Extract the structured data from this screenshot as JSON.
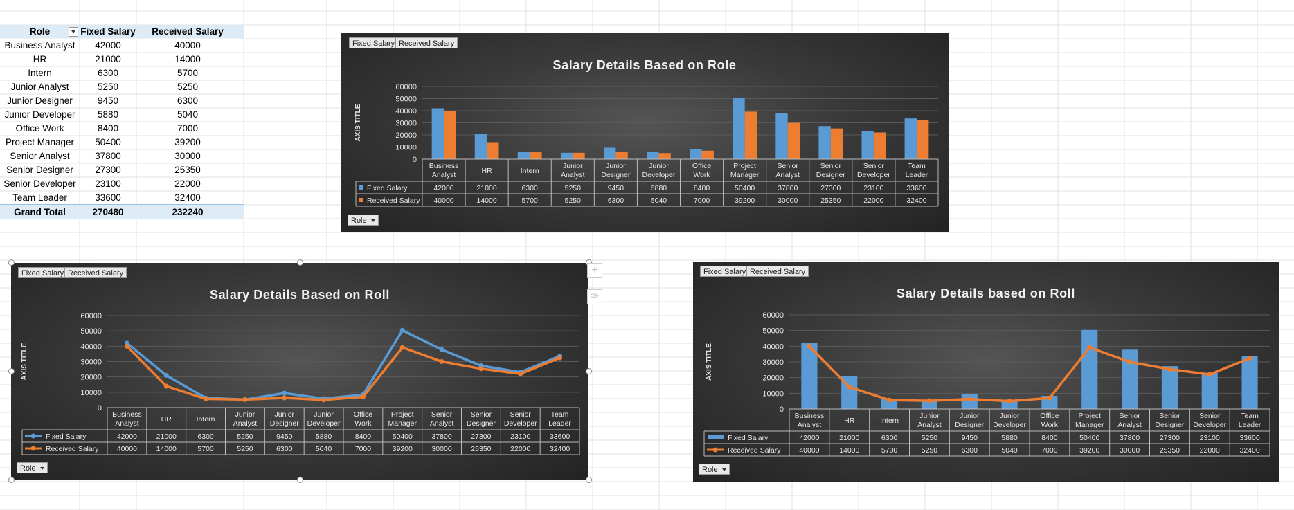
{
  "pivot": {
    "headers": [
      "Role",
      "Fixed Salary",
      "Received Salary"
    ],
    "rows": [
      {
        "role": "Business Analyst",
        "fixed": "42000",
        "received": "40000"
      },
      {
        "role": "HR",
        "fixed": "21000",
        "received": "14000"
      },
      {
        "role": "Intern",
        "fixed": "6300",
        "received": "5700"
      },
      {
        "role": "Junior Analyst",
        "fixed": "5250",
        "received": "5250"
      },
      {
        "role": "Junior Designer",
        "fixed": "9450",
        "received": "6300"
      },
      {
        "role": "Junior Developer",
        "fixed": "5880",
        "received": "5040"
      },
      {
        "role": "Office Work",
        "fixed": "8400",
        "received": "7000"
      },
      {
        "role": "Project Manager",
        "fixed": "50400",
        "received": "39200"
      },
      {
        "role": "Senior Analyst",
        "fixed": "37800",
        "received": "30000"
      },
      {
        "role": "Senior Designer",
        "fixed": "27300",
        "received": "25350"
      },
      {
        "role": "Senior Developer",
        "fixed": "23100",
        "received": "22000"
      },
      {
        "role": "Team Leader",
        "fixed": "33600",
        "received": "32400"
      }
    ],
    "total": {
      "label": "Grand Total",
      "fixed": "270480",
      "received": "232240"
    }
  },
  "field_buttons": {
    "fixed": "Fixed Salary",
    "received": "Received Salary",
    "role": "Role"
  },
  "colors": {
    "fixed": "#5b9bd5",
    "received": "#ed7d31",
    "grid": "#e0e0e0"
  },
  "icons": [
    "chart-elements-plus-icon",
    "chart-styles-brush-icon",
    "dropdown-arrow-icon"
  ],
  "chart_data": [
    {
      "type": "bar",
      "title": "Salary Details Based on Role",
      "ylabel": "AXIS TITLE",
      "ylim": [
        0,
        60000
      ],
      "yticks": [
        "0",
        "10000",
        "20000",
        "30000",
        "40000",
        "50000",
        "60000"
      ],
      "categories": [
        "Business Analyst",
        "HR",
        "Intern",
        "Junior Analyst",
        "Junior Designer",
        "Junior Developer",
        "Office Work",
        "Project Manager",
        "Senior Analyst",
        "Senior Designer",
        "Senior Developer",
        "Team Leader"
      ],
      "series": [
        {
          "name": "Fixed Salary",
          "values": [
            42000,
            21000,
            6300,
            5250,
            9450,
            5880,
            8400,
            50400,
            37800,
            27300,
            23100,
            33600
          ]
        },
        {
          "name": "Received Salary",
          "values": [
            40000,
            14000,
            5700,
            5250,
            6300,
            5040,
            7000,
            39200,
            30000,
            25350,
            22000,
            32400
          ]
        }
      ],
      "data_table": true
    },
    {
      "type": "line",
      "title": "Salary Details Based on Roll",
      "ylabel": "AXIS TITLE",
      "ylim": [
        0,
        60000
      ],
      "yticks": [
        "0",
        "10000",
        "20000",
        "30000",
        "40000",
        "50000",
        "60000"
      ],
      "categories": [
        "Business Analyst",
        "HR",
        "Intern",
        "Junior Analyst",
        "Junior Designer",
        "Junior Developer",
        "Office Work",
        "Project Manager",
        "Senior Analyst",
        "Senior Designer",
        "Senior Developer",
        "Team Leader"
      ],
      "series": [
        {
          "name": "Fixed Salary",
          "values": [
            42000,
            21000,
            6300,
            5250,
            9450,
            5880,
            8400,
            50400,
            37800,
            27300,
            23100,
            33600
          ]
        },
        {
          "name": "Received Salary",
          "values": [
            40000,
            14000,
            5700,
            5250,
            6300,
            5040,
            7000,
            39200,
            30000,
            25350,
            22000,
            32400
          ]
        }
      ],
      "data_table": true
    },
    {
      "type": "bar",
      "combo": "Fixed Salary as bars, Received Salary as line",
      "title": "Salary Details based on Roll",
      "ylabel": "AXIS TITLE",
      "ylim": [
        0,
        60000
      ],
      "yticks": [
        "0",
        "10000",
        "20000",
        "30000",
        "40000",
        "50000",
        "60000"
      ],
      "categories": [
        "Business Analyst",
        "HR",
        "Intern",
        "Junior Analyst",
        "Junior Designer",
        "Junior Developer",
        "Office Work",
        "Project Manager",
        "Senior Analyst",
        "Senior Designer",
        "Senior Developer",
        "Team Leader"
      ],
      "series": [
        {
          "name": "Fixed Salary",
          "values": [
            42000,
            21000,
            6300,
            5250,
            9450,
            5880,
            8400,
            50400,
            37800,
            27300,
            23100,
            33600
          ]
        },
        {
          "name": "Received Salary",
          "values": [
            40000,
            14000,
            5700,
            5250,
            6300,
            5040,
            7000,
            39200,
            30000,
            25350,
            22000,
            32400
          ]
        }
      ],
      "data_table": true
    }
  ]
}
